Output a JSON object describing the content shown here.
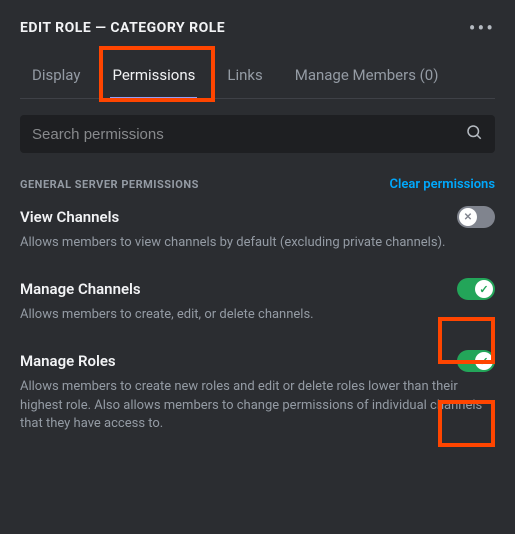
{
  "header": {
    "title": "EDIT ROLE — CATEGORY ROLE"
  },
  "tabs": {
    "display": "Display",
    "permissions": "Permissions",
    "links": "Links",
    "manage_members": "Manage Members (0)"
  },
  "search": {
    "placeholder": "Search permissions"
  },
  "section": {
    "label": "GENERAL SERVER PERMISSIONS",
    "clear": "Clear permissions"
  },
  "permissions": {
    "view_channels": {
      "title": "View Channels",
      "desc": "Allows members to view channels by default (excluding private channels).",
      "enabled": false
    },
    "manage_channels": {
      "title": "Manage Channels",
      "desc": "Allows members to create, edit, or delete channels.",
      "enabled": true
    },
    "manage_roles": {
      "title": "Manage Roles",
      "desc": "Allows members to create new roles and edit or delete roles lower than their highest role. Also allows members to change permissions of individual channels that they have access to.",
      "enabled": true
    }
  }
}
